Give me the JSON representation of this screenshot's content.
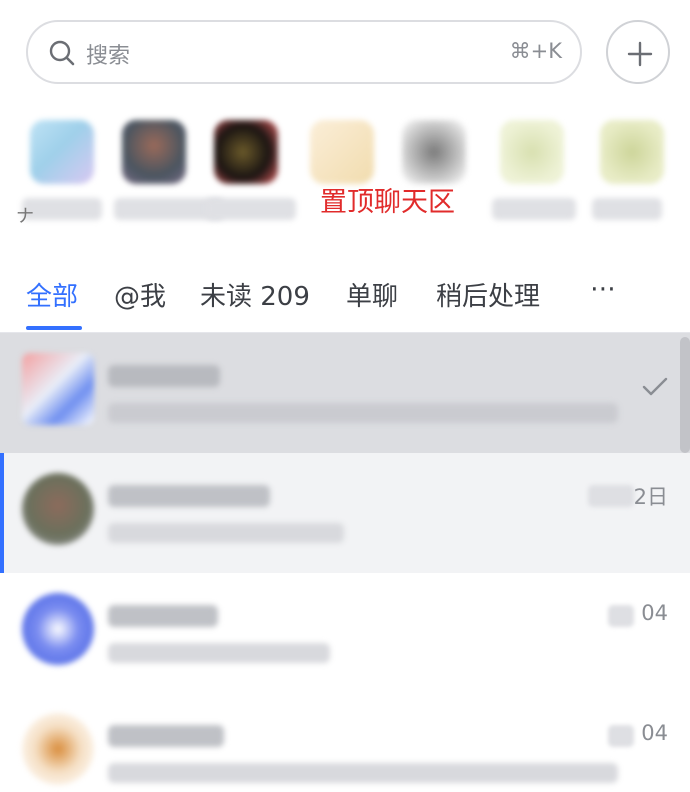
{
  "search": {
    "placeholder": "搜索",
    "shortcut": "⌘+K",
    "add_icon": "plus-icon",
    "search_icon": "search-icon"
  },
  "pinned": {
    "label": "置顶聊天区",
    "clipped_name_char": "ナ"
  },
  "tabs": [
    {
      "label": "全部",
      "active": true
    },
    {
      "label": "@我",
      "active": false
    },
    {
      "label": "未读 209",
      "active": false
    },
    {
      "label": "单聊",
      "active": false
    },
    {
      "label": "稍后处理",
      "active": false
    }
  ],
  "tab_more": "⋯",
  "chats": [
    {
      "time": "",
      "state": "done"
    },
    {
      "time": "2日",
      "state": "selected"
    },
    {
      "time": "04",
      "state": "normal"
    },
    {
      "time": "04",
      "state": "normal"
    }
  ],
  "colors": {
    "accent": "#3370ff",
    "pinned_label": "#e12b2b",
    "done_row_bg": "#dcdde1",
    "selected_row_bg": "#f2f3f5"
  }
}
